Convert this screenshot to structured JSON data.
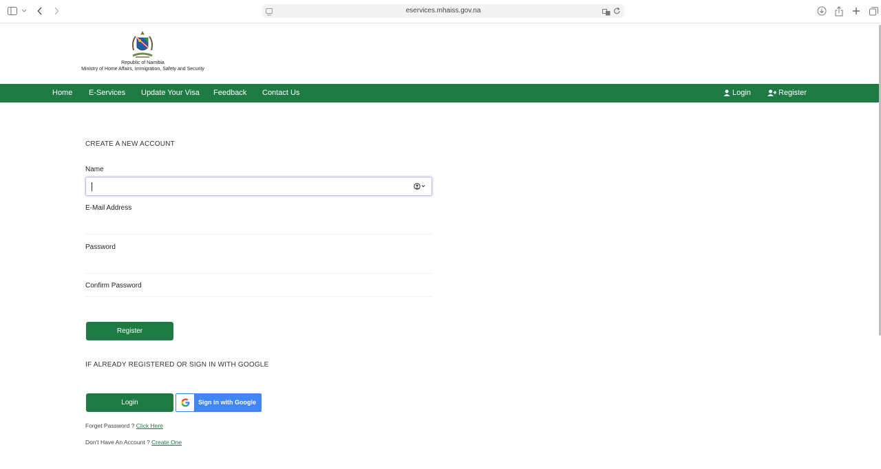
{
  "browser": {
    "url": "eservices.mhaiss.gov.na",
    "icons": [
      "sidebar-icon",
      "chevron-down-icon",
      "back-icon",
      "forward-icon",
      "tab-icon",
      "translate-icon",
      "reload-icon",
      "download-icon",
      "share-icon",
      "new-tab-icon",
      "tabs-overview-icon"
    ]
  },
  "header": {
    "republic": "Republic of Namibia",
    "ministry": "Ministry of Home Affairs, Immigration, Safety and Security"
  },
  "nav": {
    "items": [
      "Home",
      "E-Services",
      "Update Your Visa",
      "Feedback",
      "Contact Us"
    ],
    "login": "Login",
    "register": "Register"
  },
  "form": {
    "title": "CREATE A NEW ACCOUNT",
    "name_label": "Name",
    "name_value": "",
    "email_label": "E-Mail Address",
    "password_label": "Password",
    "confirm_label": "Confirm Password",
    "register_button": "Register"
  },
  "signin": {
    "note": "IF ALREADY REGISTERED OR SIGN IN WITH GOOGLE",
    "login_button": "Login",
    "google_button": "Sign in with Google",
    "forget_text": "Forget Password ?",
    "forget_link": "Click Here",
    "no_account_text": "Don't Have An Account ?",
    "create_link": "Create One"
  },
  "colors": {
    "brand_green": "#1e7b43",
    "google_blue": "#4285f4"
  }
}
